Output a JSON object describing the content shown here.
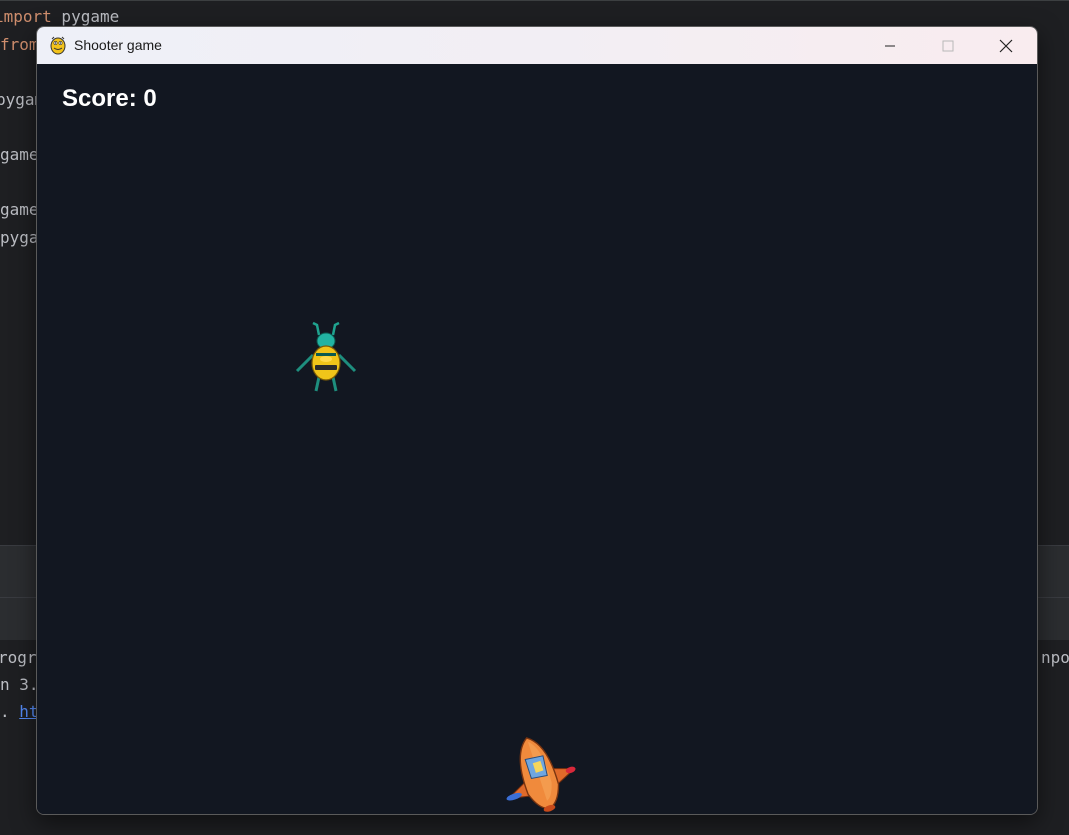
{
  "ide": {
    "code_lines": [
      {
        "keyword": "import",
        "rest": " pygame"
      },
      {
        "keyword": "from",
        "rest": ""
      },
      {
        "keyword": "",
        "rest": "pygam"
      },
      {
        "keyword": "",
        "rest": "game"
      },
      {
        "keyword": "",
        "rest": "game"
      },
      {
        "keyword": "",
        "rest": "pygam"
      }
    ],
    "console_lines": {
      "left_1": "rogr",
      "left_2": "n 3.",
      "left_3_prefix": ". ",
      "left_3_link": "ht",
      "right_1": "npo"
    }
  },
  "window": {
    "title": "Shooter game",
    "app_icon": "pygame-snake-icon",
    "controls": [
      "minimize-icon",
      "maximize-icon",
      "close-icon"
    ]
  },
  "game": {
    "score_label": "Score: 0",
    "score_value": 0,
    "enemies": [
      {
        "sprite": "beetle-alien-icon"
      }
    ],
    "player": {
      "sprite": "orange-spaceship-icon"
    }
  },
  "colors": {
    "canvas_bg": "#121721",
    "score_text": "#ffffff",
    "ide_keyword": "#cf8e6d",
    "ide_text": "#bcbec4"
  }
}
